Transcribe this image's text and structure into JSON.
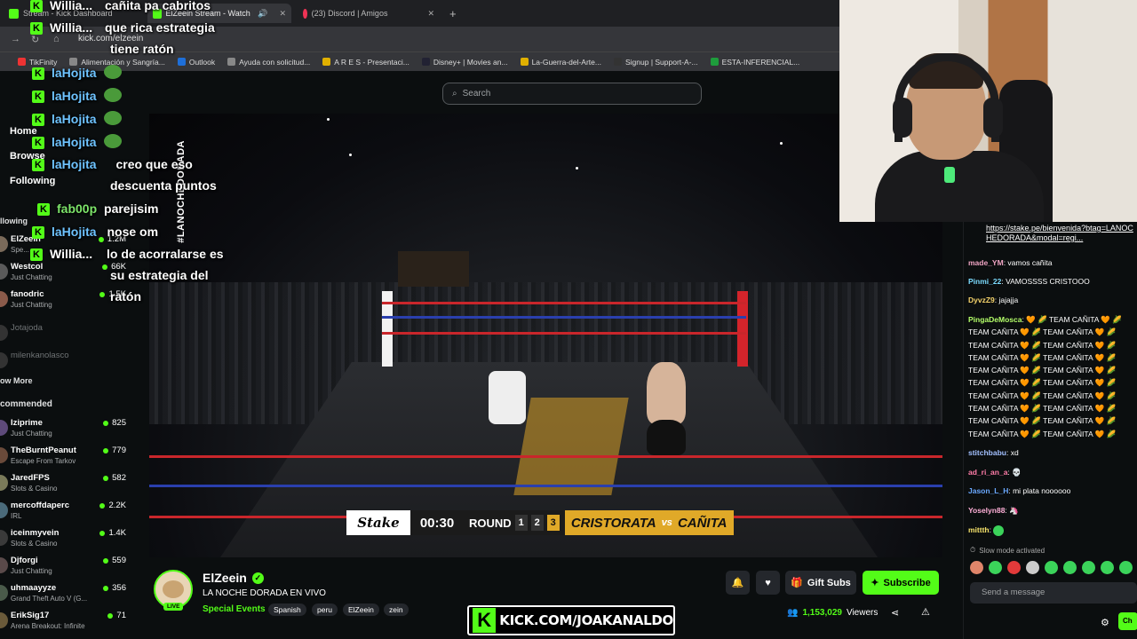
{
  "browser": {
    "tabs": [
      {
        "label": "Stream - Kick Dashboard"
      },
      {
        "label": "ElZeein Stream - Watch Live"
      },
      {
        "label": "(23) Discord | Amigos"
      }
    ],
    "url": "kick.com/elzeein",
    "bookmarks": [
      "TikFinity",
      "Alimentación y Sangría...",
      "Outlook",
      "Ayuda con solicitud...",
      "A R E S - Presentaci...",
      "Disney+ | Movies an...",
      "La-Guerra-del-Arte...",
      "Signup | Support-A-...",
      "ESTA-INFERENCIAL..."
    ]
  },
  "kick": {
    "search_placeholder": "Search"
  },
  "sidebar": {
    "links": [
      "Home",
      "Browse",
      "Following"
    ],
    "following_header": "llowing",
    "following": [
      {
        "name": "ElZeein",
        "category": "Spe...",
        "viewers": "1.2M",
        "live": true
      },
      {
        "name": "Westcol",
        "category": "Just Chatting",
        "viewers": "66K",
        "live": true
      },
      {
        "name": "fanodric",
        "category": "Just Chatting",
        "viewers": "1.5K",
        "live": true
      },
      {
        "name": "Jotajoda",
        "category": "",
        "viewers": "",
        "live": false
      },
      {
        "name": "milenkanolasco",
        "category": "",
        "viewers": "",
        "live": false
      }
    ],
    "show_more": "ow More",
    "recommended_header": "commended",
    "recommended": [
      {
        "name": "Iziprime",
        "category": "Just Chatting",
        "viewers": "825"
      },
      {
        "name": "TheBurntPeanut",
        "category": "Escape From Tarkov",
        "viewers": "779"
      },
      {
        "name": "JaredFPS",
        "category": "Slots & Casino",
        "viewers": "582"
      },
      {
        "name": "mercoffdaperc",
        "category": "IRL",
        "viewers": "2.2K"
      },
      {
        "name": "iceinmyvein",
        "category": "Slots & Casino",
        "viewers": "1.4K"
      },
      {
        "name": "Djforgi",
        "category": "Just Chatting",
        "viewers": "559"
      },
      {
        "name": "uhmaayyze",
        "category": "Grand Theft Auto V (G...",
        "viewers": "356"
      },
      {
        "name": "ErikSig17",
        "category": "Arena Breakout: Infinite",
        "viewers": "71"
      }
    ]
  },
  "video": {
    "hashtag": "#LANOCHEDORADA",
    "scorebug": {
      "sponsor": "Stake",
      "time": "00:30",
      "round_label": "ROUND",
      "rounds": [
        "1",
        "2",
        "3"
      ],
      "current_round": "3",
      "fighter_a": "CRISTORATA",
      "vs": "vs",
      "fighter_b": "CAÑITA"
    }
  },
  "channel": {
    "name": "ElZeein",
    "live_badge": "LIVE",
    "title": "LA NOCHE DORADA EN VIVO",
    "category": "Special Events",
    "tags": [
      "Spanish",
      "peru",
      "ElZeein",
      "zein"
    ],
    "gift_label": "Gift Subs",
    "subscribe_label": "Subscribe",
    "viewers": "1,153,029",
    "viewers_label": "Viewers"
  },
  "overlay_banner": {
    "text": "KICK.COM/JOAKANALDO"
  },
  "overlay_chat": [
    {
      "user": "Willia...",
      "msg": "cañita pa cabritos"
    },
    {
      "user": "Willia...",
      "msg": "que rica estrategia"
    },
    {
      "user": "",
      "msg": "tiene ratón"
    },
    {
      "user": "laHojita",
      "msg": ""
    },
    {
      "user": "laHojita",
      "msg": ""
    },
    {
      "user": "laHojita",
      "msg": ""
    },
    {
      "user": "laHojita",
      "msg": ""
    },
    {
      "user": "laHojita",
      "msg": "creo que eso"
    },
    {
      "user": "",
      "msg": "descuenta puntos"
    },
    {
      "user": "fab00p",
      "msg": "parejisim"
    },
    {
      "user": "laHojita",
      "msg": "nose om"
    },
    {
      "user": "Willia...",
      "msg": "lo de acorralarse es"
    },
    {
      "user": "",
      "msg": "su estrategia del"
    },
    {
      "user": "",
      "msg": "ratón"
    }
  ],
  "chat": {
    "rules_link": "https://stake.pe/bienvenida?btag=LANOCHEDORADA&modal=regi...",
    "messages": [
      {
        "user": "made_YM",
        "color": "#f0a5c4",
        "text": "vamos cañita"
      },
      {
        "user": "Pinmi_22",
        "color": "#7cdcff",
        "text": "VAMOSSSS CRISTOOO"
      },
      {
        "user": "DyvzZ9",
        "color": "#f5d36b",
        "text": "jajajja"
      },
      {
        "user": "PingaDeMosca",
        "color": "#b4ff6a",
        "text": "🧡 🌽 TEAM CAÑITA 🧡 🌽 TEAM CAÑITA 🧡 🌽 TEAM CAÑITA 🧡 🌽 TEAM CAÑITA 🧡 🌽 TEAM CAÑITA 🧡 🌽 TEAM CAÑITA 🧡 🌽 TEAM CAÑITA 🧡 🌽 TEAM CAÑITA 🧡 🌽 TEAM CAÑITA 🧡 🌽 TEAM CAÑITA 🧡 🌽 TEAM CAÑITA 🧡 🌽 TEAM CAÑITA 🧡 🌽 TEAM CAÑITA 🧡 🌽 TEAM CAÑITA 🧡 🌽 TEAM CAÑITA 🧡 🌽 TEAM CAÑITA 🧡 🌽 TEAM CAÑITA 🧡 🌽 TEAM CAÑITA 🧡 🌽 TEAM CAÑITA 🧡 🌽 TEAM CAÑITA 🧡 🌽 TEAM CAÑITA 🧡 🌽 TEAM CAÑITA 🧡 🌽"
      },
      {
        "user": "stitchbabu",
        "color": "#a3c0ff",
        "text": "xd"
      },
      {
        "user": "ad_ri_an_a",
        "color": "#ff7ca8",
        "text": "💀"
      },
      {
        "user": "Jason_L_H",
        "color": "#6aa8ff",
        "text": "mi plata noooooo"
      },
      {
        "user": "Yoselyn88",
        "color": "#ffb0d8",
        "text": "🦄"
      },
      {
        "user": "mittth",
        "color": "#f7e36b",
        "text": ""
      }
    ],
    "slow_mode": "Slow mode activated",
    "input_placeholder": "Send a message",
    "send_label": "Ch"
  }
}
